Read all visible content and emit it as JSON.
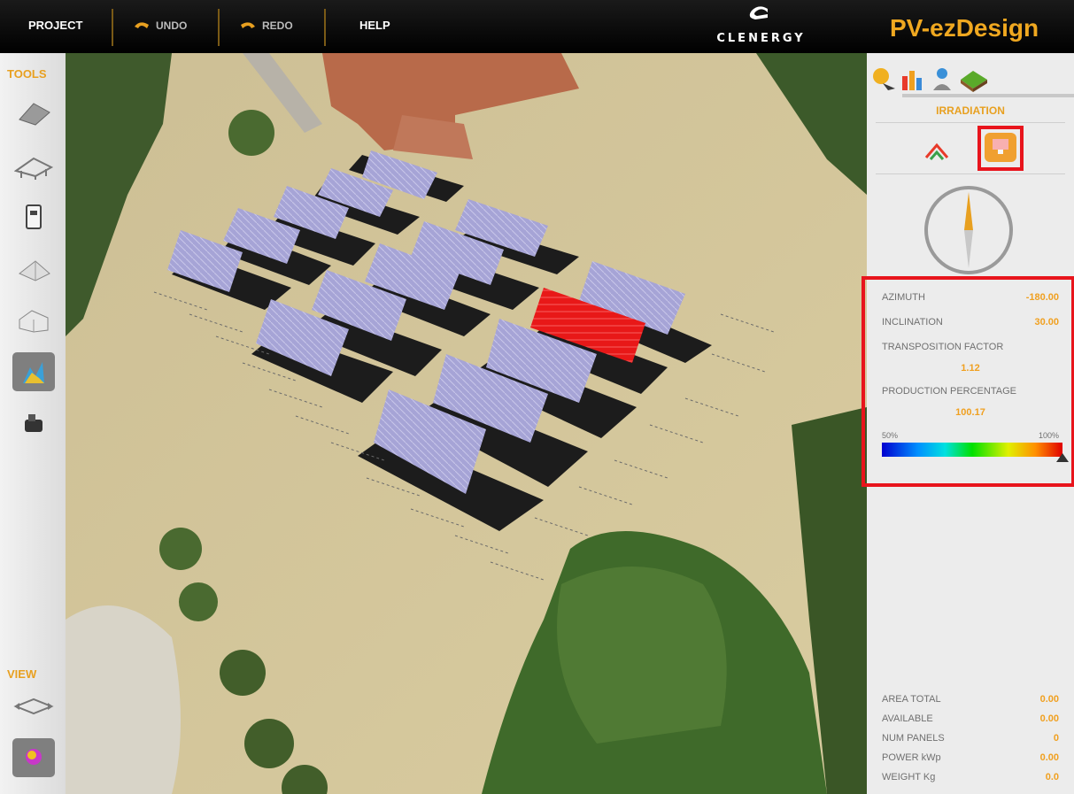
{
  "toolbar": {
    "project_label": "PROJECT",
    "undo_label": "UNDO",
    "redo_label": "REDO",
    "help_label": "HELP",
    "brand_word": "CLENERGY",
    "app_name": "PV-ezDesign"
  },
  "leftbar": {
    "tools_label": "TOOLS",
    "view_label": "VIEW",
    "tools": [
      "roof-panel-icon",
      "ground-mount-icon",
      "inverter-icon",
      "terrain-icon",
      "building-icon",
      "irradiation-chart-icon",
      "camera-icon"
    ],
    "active_tool": "irradiation-chart-icon",
    "views": [
      "rotate-view-icon",
      "sun-path-icon"
    ]
  },
  "panel": {
    "tabs": [
      "sun-tab-icon",
      "chart-tab-icon",
      "person-tab-icon",
      "terrain-tab-icon"
    ],
    "section_title": "IRRADIATION",
    "azimuth_label": "AZIMUTH",
    "azimuth_value": "-180.00",
    "inclination_label": "INCLINATION",
    "inclination_value": "30.00",
    "transposition_label": "TRANSPOSITION FACTOR",
    "transposition_value": "1.12",
    "production_label": "PRODUCTION PERCENTAGE",
    "production_value": "100.17",
    "scale_min": "50%",
    "scale_max": "100%",
    "scale_marker_fraction": 1.0,
    "summary": [
      {
        "label": "AREA TOTAL",
        "value": "0.00"
      },
      {
        "label": "AVAILABLE",
        "value": "0.00"
      },
      {
        "label": "NUM PANELS",
        "value": "0"
      },
      {
        "label": "POWER kWp",
        "value": "0.00"
      },
      {
        "label": "WEIGHT Kg",
        "value": "0.0"
      }
    ]
  },
  "colors": {
    "accent": "#f0a820",
    "highlight": "#e8141c",
    "selected_panel": "#e81818",
    "panel": "#a8a8d8"
  }
}
